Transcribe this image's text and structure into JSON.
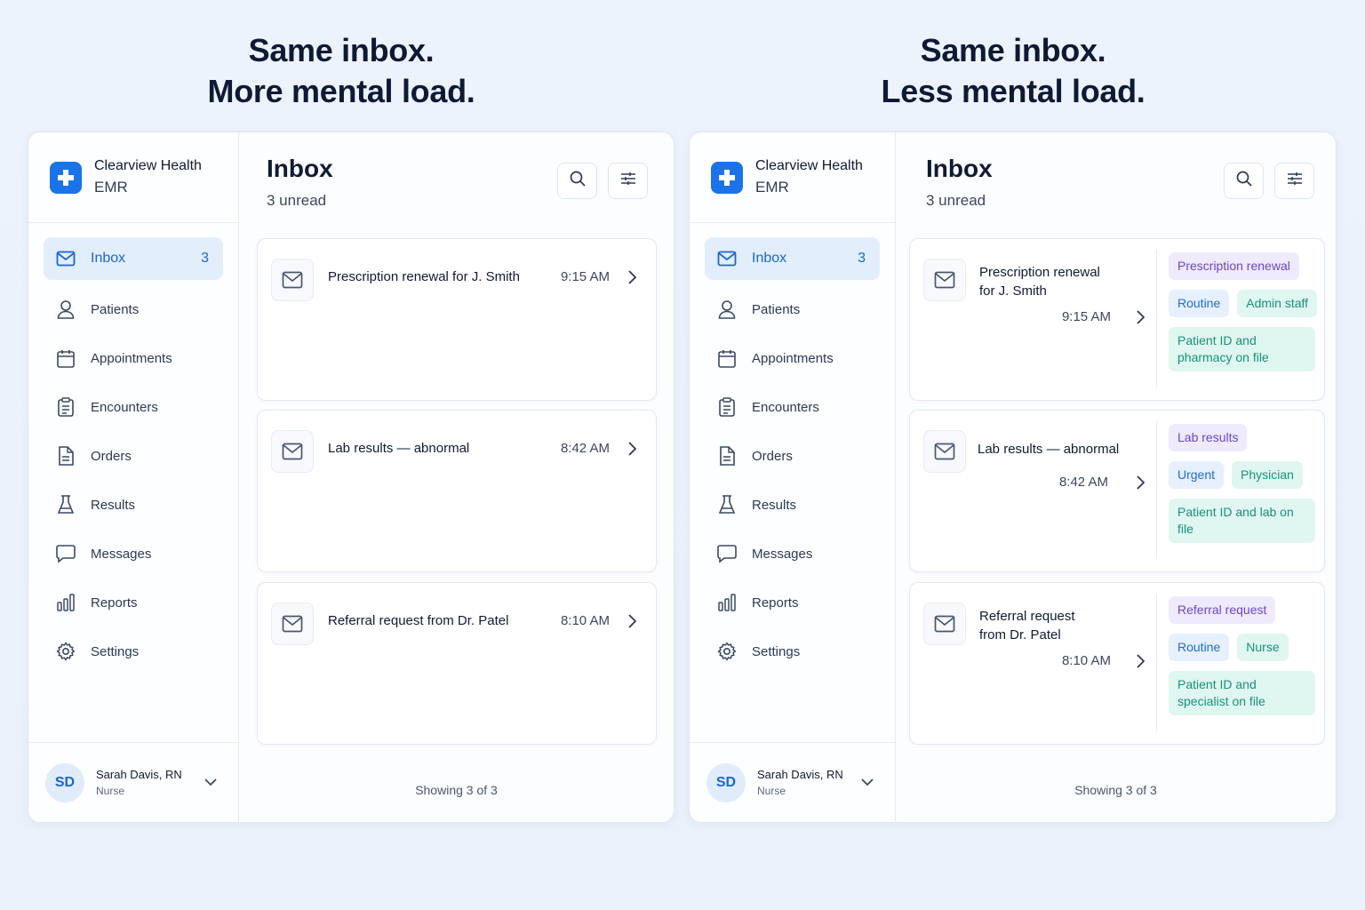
{
  "headlines": {
    "left": [
      "Same inbox.",
      "More mental load."
    ],
    "right": [
      "Same inbox.",
      "Less mental load."
    ]
  },
  "brand": {
    "name": "Clearview Health",
    "sub": "EMR"
  },
  "nav": [
    {
      "label": "Inbox",
      "count": "3",
      "icon": "mail-icon"
    },
    {
      "label": "Patients",
      "icon": "user-icon"
    },
    {
      "label": "Appointments",
      "icon": "calendar-icon"
    },
    {
      "label": "Encounters",
      "icon": "clipboard-icon"
    },
    {
      "label": "Orders",
      "icon": "document-icon"
    },
    {
      "label": "Results",
      "icon": "flask-icon"
    },
    {
      "label": "Messages",
      "icon": "chat-icon"
    },
    {
      "label": "Reports",
      "icon": "bar-chart-icon"
    },
    {
      "label": "Settings",
      "icon": "gear-icon"
    }
  ],
  "user": {
    "initials": "SD",
    "name": "Sarah Davis, RN",
    "role": "Nurse"
  },
  "inbox": {
    "title": "Inbox",
    "unread": "3 unread",
    "footer": "Showing 3 of 3",
    "messages": [
      {
        "subject": "Prescription renewal for J. Smith",
        "subject_lines": [
          "Prescription renewal",
          "for J. Smith"
        ],
        "time": "9:15 AM",
        "type_tag": "Prescription renewal",
        "priority": "Routine",
        "owner": "Admin staff",
        "context": "Patient ID and pharmacy on file"
      },
      {
        "subject": "Lab results — abnormal",
        "subject_lines": [
          "Lab results — abnormal"
        ],
        "time": "8:42 AM",
        "type_tag": "Lab results",
        "priority": "Urgent",
        "owner": "Physician",
        "context": "Patient ID and lab on file"
      },
      {
        "subject": "Referral request from Dr. Patel",
        "subject_lines": [
          "Referral request",
          "from Dr. Patel"
        ],
        "time": "8:10 AM",
        "type_tag": "Referral request",
        "priority": "Routine",
        "owner": "Nurse",
        "context": "Patient ID and specialist on file"
      }
    ]
  },
  "colors": {
    "accent": "#1a73e8",
    "tag_type": "#6a47c9",
    "tag_priority": "#1f6bd8",
    "tag_owner": "#17927a"
  }
}
